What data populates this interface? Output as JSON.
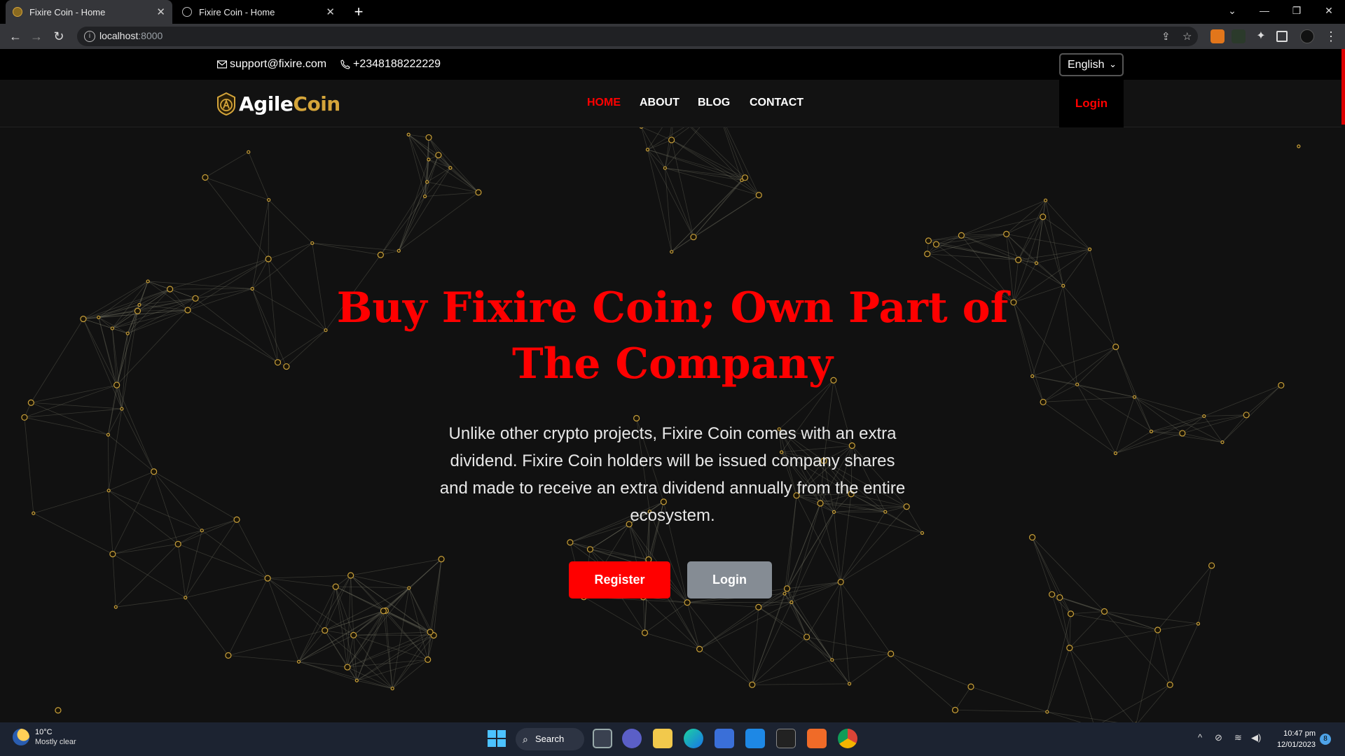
{
  "browser": {
    "tabs": [
      {
        "title": "Fixire Coin - Home",
        "active": true
      },
      {
        "title": "Fixire Coin - Home",
        "active": false
      }
    ],
    "url_host": "localhost",
    "url_port": ":8000"
  },
  "topbar": {
    "email": "support@fixire.com",
    "phone": "+2348188222229",
    "language": "English"
  },
  "nav": {
    "logo_part1": "Agile",
    "logo_part2": "Coin",
    "items": [
      {
        "label": "HOME",
        "active": true
      },
      {
        "label": "ABOUT",
        "active": false
      },
      {
        "label": "BLOG",
        "active": false
      },
      {
        "label": "CONTACT",
        "active": false
      }
    ],
    "login_label": "Login"
  },
  "hero": {
    "title_line1": "Buy Fixire Coin; Own Part of",
    "title_line2": "The Company",
    "text": "Unlike other crypto projects, Fixire Coin comes with an extra dividend. Fixire Coin holders will be issued company shares and made to receive an extra dividend annually from the entire ecosystem.",
    "register_label": "Register",
    "login_label": "Login"
  },
  "colors": {
    "accent": "#ff0000",
    "gold": "#d5a53a",
    "page_bg": "#111111",
    "secondary_button": "#858c94"
  },
  "taskbar": {
    "weather_temp": "10°C",
    "weather_desc": "Mostly clear",
    "search_label": "Search",
    "time": "10:47 pm",
    "date": "12/01/2023",
    "notification_count": "8"
  }
}
